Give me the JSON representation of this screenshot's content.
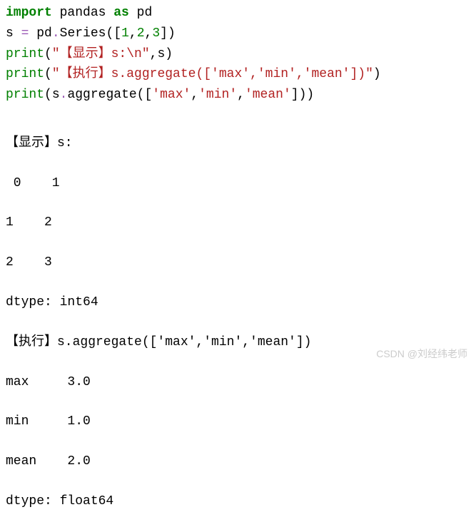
{
  "code": {
    "line1": {
      "import": "import",
      "module": " pandas ",
      "as": "as",
      "alias": " pd"
    },
    "line2": {
      "var": "s ",
      "op": "=",
      "expr1": " pd",
      "dot": ".",
      "method": "Series",
      "lp": "(",
      "lb": "[",
      "n1": "1",
      "c1": ",",
      "n2": "2",
      "c2": ",",
      "n3": "3",
      "rb": "]",
      "rp": ")"
    },
    "line3": {
      "fn": "print",
      "lp": "(",
      "str": "\"【显示】s:\\n\"",
      "c": ",",
      "var": "s",
      "rp": ")"
    },
    "line4": {
      "fn": "print",
      "lp": "(",
      "str": "\"【执行】s.aggregate(['max','min','mean'])\"",
      "rp": ")"
    },
    "line5": {
      "fn": "print",
      "lp": "(",
      "var": "s",
      "dot": ".",
      "method": "aggregate",
      "lp2": "(",
      "lb": "[",
      "s1": "'max'",
      "c1": ",",
      "s2": "'min'",
      "c2": ",",
      "s3": "'mean'",
      "rb": "]",
      "rp2": ")",
      "rp": ")"
    }
  },
  "output": {
    "line1": "【显示】s:",
    "line2": " 0    1",
    "line3": "1    2",
    "line4": "2    3",
    "line5": "dtype: int64",
    "line6": "【执行】s.aggregate(['max','min','mean'])",
    "line7": "max     3.0",
    "line8": "min     1.0",
    "line9": "mean    2.0",
    "line10": "dtype: float64"
  },
  "watermark": "CSDN @刘经纬老师"
}
